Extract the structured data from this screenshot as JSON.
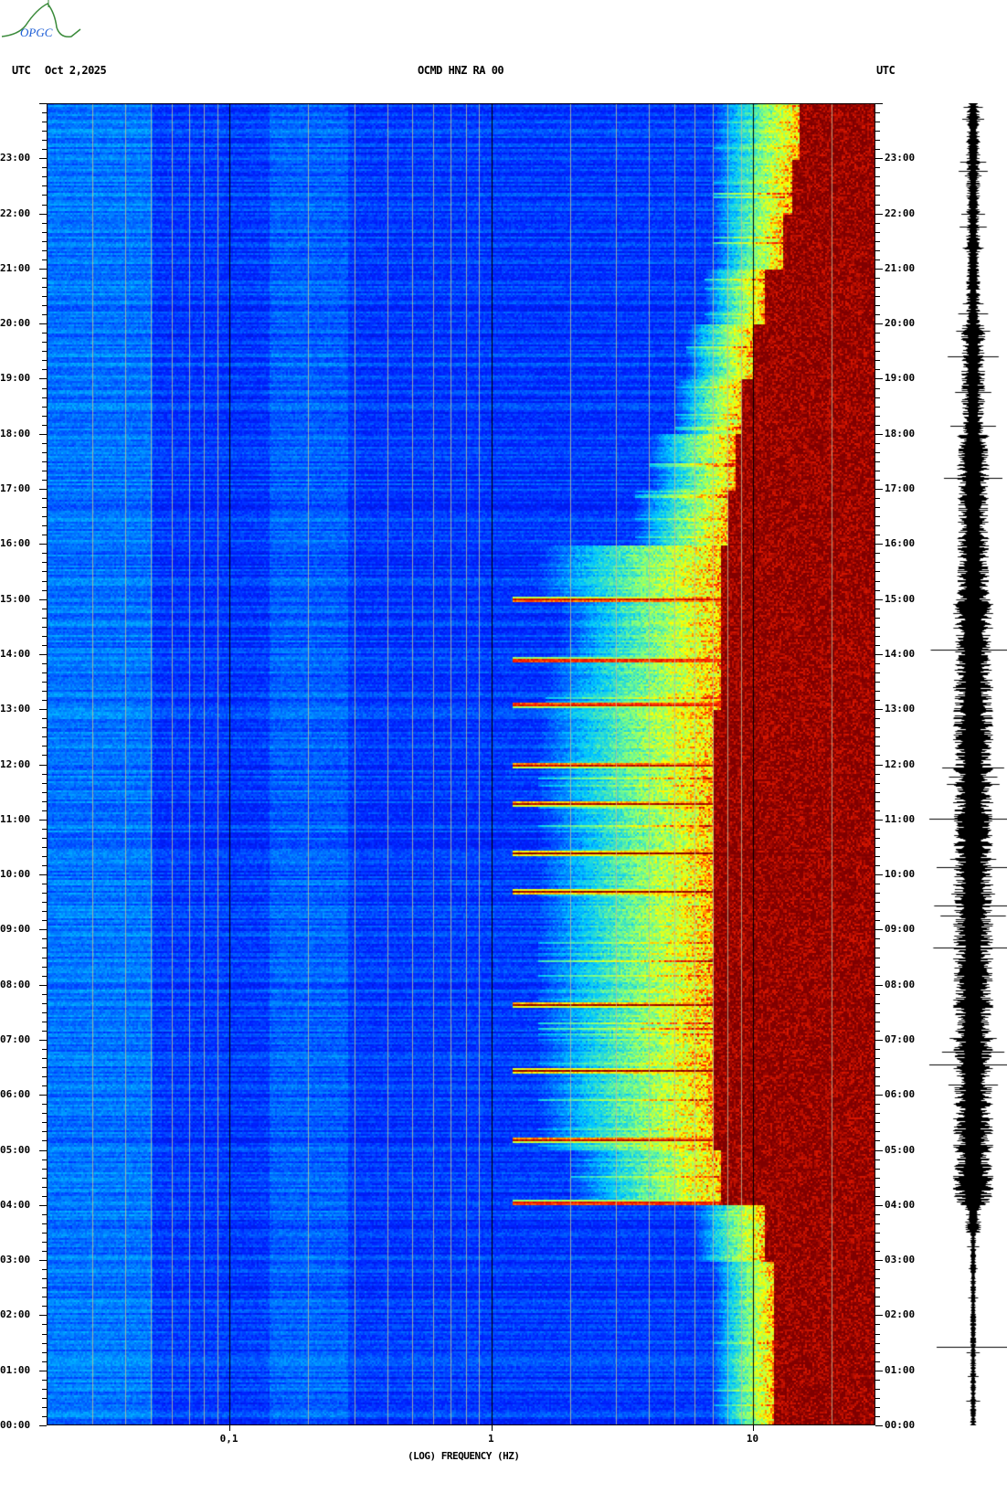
{
  "header": {
    "logo_text": "OPGC",
    "left_label": "UTC",
    "date": "Oct 2,2025",
    "station": "OCMD HNZ RA 00",
    "right_label": "UTC"
  },
  "chart_data": {
    "type": "heatmap",
    "title": "OCMD HNZ RA 00",
    "date": "Oct 2,2025",
    "xlabel": "(LOG) FREQUENCY (HZ)",
    "ylabel": "UTC",
    "xscale": "log",
    "xlim": [
      0.02,
      29.4
    ],
    "ylim_hours": [
      0,
      24
    ],
    "x_ticks": [
      {
        "value": 0.1,
        "label": "0,1"
      },
      {
        "value": 1,
        "label": "1"
      },
      {
        "value": 10,
        "label": "10"
      }
    ],
    "y_ticks": [
      "00:00",
      "01:00",
      "02:00",
      "03:00",
      "04:00",
      "05:00",
      "06:00",
      "07:00",
      "08:00",
      "09:00",
      "10:00",
      "11:00",
      "12:00",
      "13:00",
      "14:00",
      "15:00",
      "16:00",
      "17:00",
      "18:00",
      "19:00",
      "20:00",
      "21:00",
      "22:00",
      "23:00"
    ],
    "colormap": [
      "#00008f",
      "#0020ff",
      "#00c8ff",
      "#80ff80",
      "#ffff00",
      "#ff2000",
      "#800000"
    ],
    "hourly_saturation_onset_hz": [
      12,
      12,
      12,
      11,
      7.5,
      7,
      7,
      7,
      7,
      7,
      7,
      7,
      7,
      7.5,
      7.5,
      7.5,
      8,
      8.5,
      9,
      10,
      11,
      13,
      14,
      15
    ],
    "hourly_noise_onset_hz": [
      7,
      7,
      7,
      6,
      2,
      1.5,
      1.5,
      1.5,
      1.5,
      1.5,
      1.5,
      1.5,
      1.5,
      1.6,
      1.8,
      1.5,
      3.5,
      4,
      5,
      5.5,
      6.5,
      7,
      7,
      7
    ],
    "transient_events_hours": [
      4.05,
      5.2,
      6.45,
      7.65,
      9.7,
      10.4,
      11.3,
      12.0,
      13.1,
      13.9,
      15.0
    ],
    "grid": "vertical decade lines"
  },
  "seismogram": {
    "label": "HNZ trace"
  }
}
